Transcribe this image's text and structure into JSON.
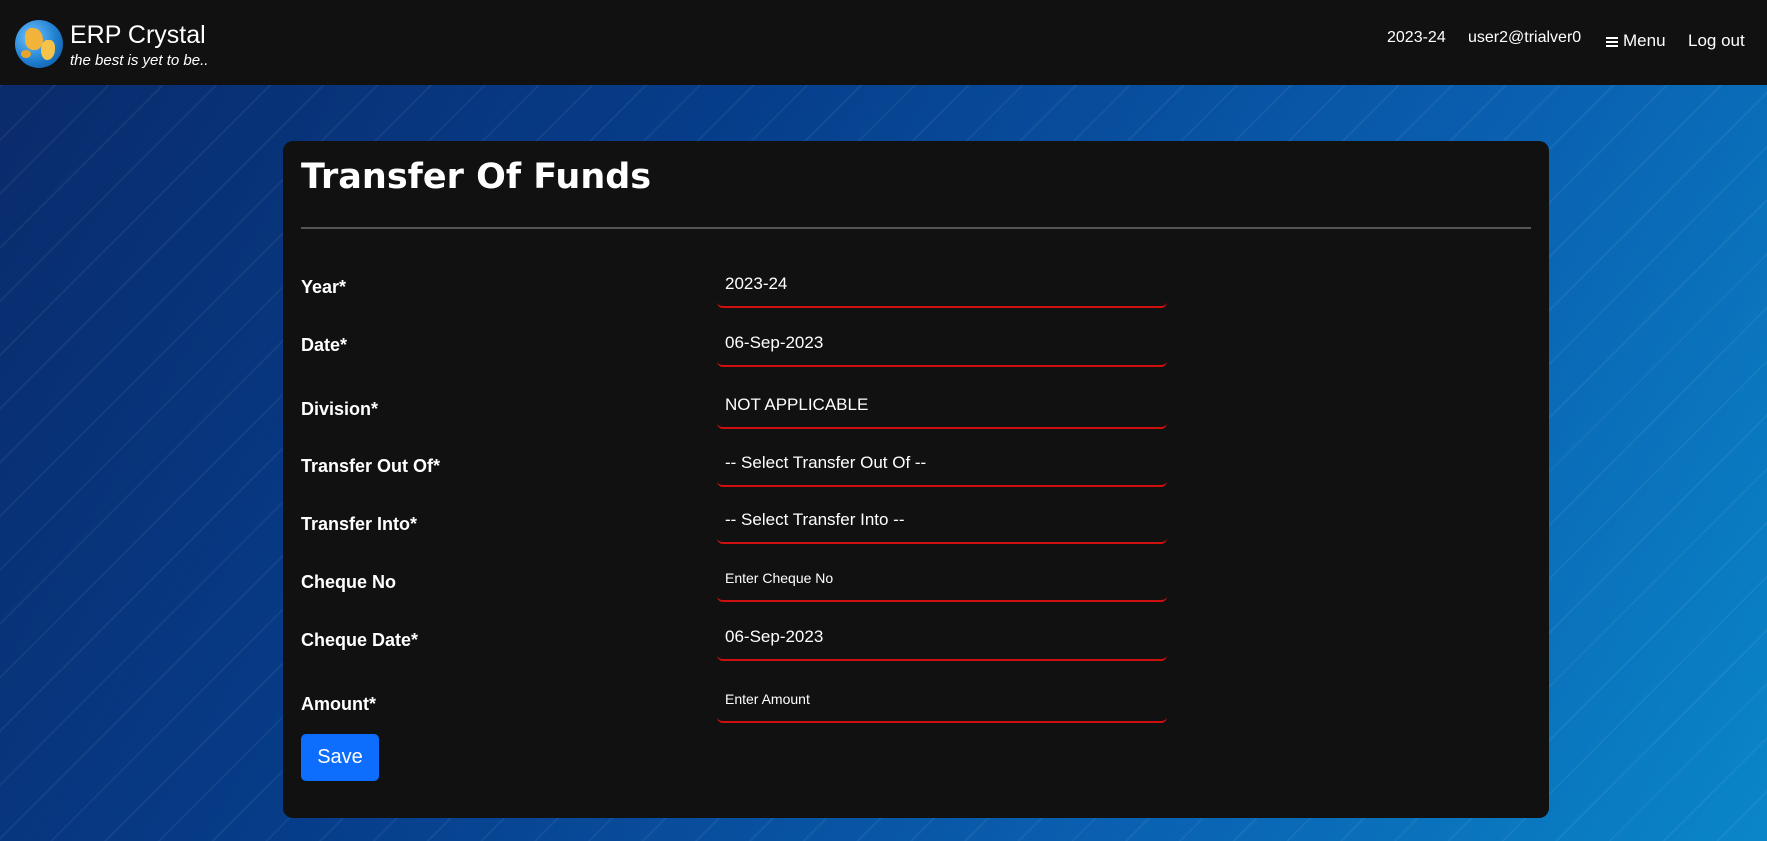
{
  "app": {
    "title": "ERP Crystal",
    "tagline": "the best is yet to be.."
  },
  "nav": {
    "year": "2023-24",
    "user": "user2@trialver0",
    "menu_label": "Menu",
    "menu_icon": "hamburger-icon",
    "logout_label": "Log out"
  },
  "page": {
    "title": "Transfer Of Funds"
  },
  "form": {
    "year": {
      "label": "Year*",
      "value": "2023-24"
    },
    "date": {
      "label": "Date*",
      "value": "06-Sep-2023"
    },
    "division": {
      "label": "Division*",
      "value": "NOT APPLICABLE"
    },
    "transfer_out": {
      "label": "Transfer Out Of*",
      "value": "-- Select Transfer Out Of --"
    },
    "transfer_into": {
      "label": "Transfer Into*",
      "value": "-- Select Transfer Into --"
    },
    "cheque_no": {
      "label": "Cheque No",
      "placeholder": "Enter Cheque No"
    },
    "cheque_date": {
      "label": "Cheque Date*",
      "value": "06-Sep-2023"
    },
    "amount": {
      "label": "Amount*",
      "placeholder": "Enter Amount"
    },
    "save_label": "Save"
  },
  "colors": {
    "accent": "#0d6efd",
    "field_underline": "#d0100e",
    "panel": "#111111"
  }
}
